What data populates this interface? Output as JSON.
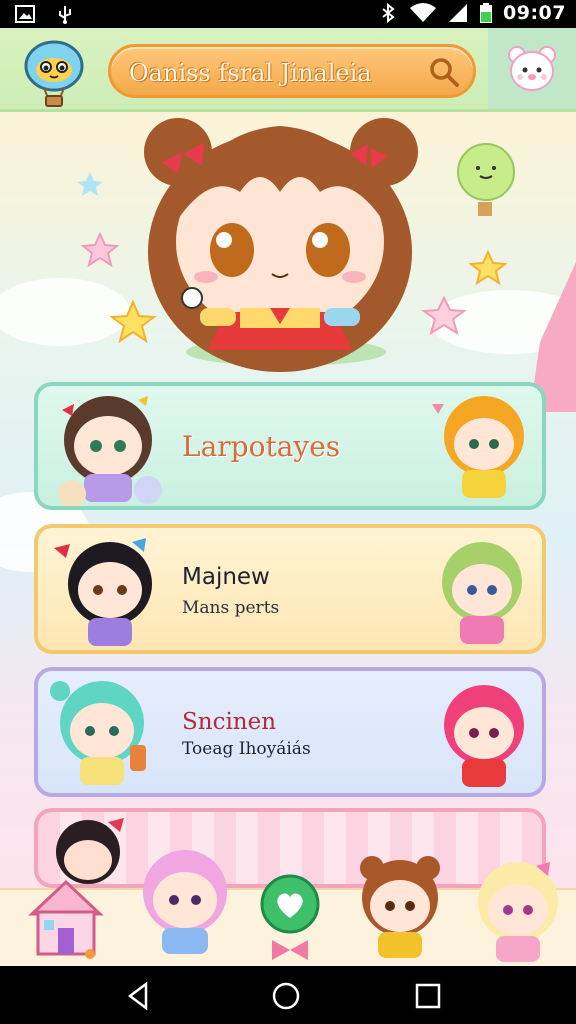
{
  "status_bar": {
    "time": "09:07",
    "icons": [
      "gallery-icon",
      "usb-icon",
      "bluetooth-icon",
      "wifi-icon",
      "signal-icon",
      "battery-icon"
    ]
  },
  "header": {
    "logo": "hot-air-balloon-logo",
    "search_text": "Oaniss fsral Jinaleia",
    "search_icon": "search-icon",
    "profile_icon": "bear-face-icon"
  },
  "cards": [
    {
      "title": "Larpotayes",
      "subtitle": ""
    },
    {
      "title": "Majnew",
      "subtitle": "Mans perts"
    },
    {
      "title": "Sncinen",
      "subtitle": "Toeag Ihoyáiás"
    },
    {
      "title": "",
      "subtitle": ""
    }
  ],
  "dock": {
    "items": [
      "house-icon",
      "pink-chibi",
      "heart-badge-icon",
      "brown-chibi",
      "blonde-chibi"
    ]
  },
  "navbar": {
    "buttons": [
      "back-icon",
      "home-icon",
      "recents-icon"
    ]
  },
  "colors": {
    "header_bg": "#d9f1c0",
    "search_bg": "#f4a84b",
    "card1": "#c9f0e0",
    "card2": "#fde6b3",
    "card3": "#d7e4fa",
    "card4": "#fcd3e0"
  }
}
